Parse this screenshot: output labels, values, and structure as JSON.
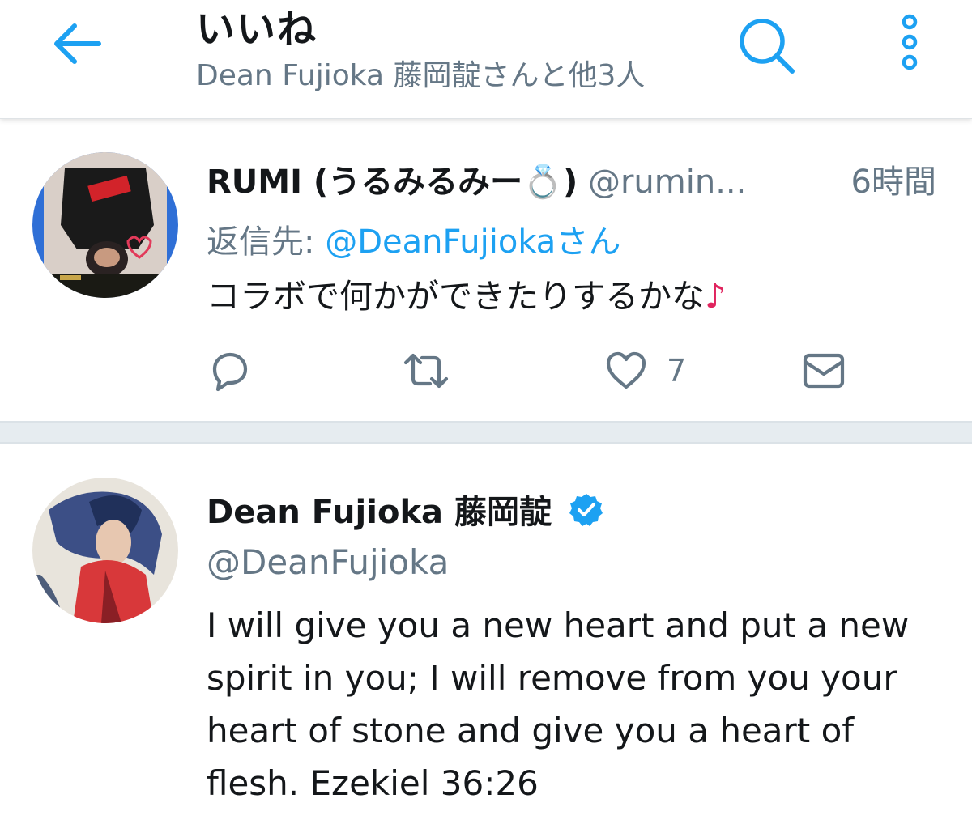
{
  "header": {
    "title": "いいね",
    "subtitle": "Dean Fujioka 藤岡靛さんと他3人"
  },
  "colors": {
    "accent": "#1da1f2",
    "secondary_text": "#657786",
    "primary_text": "#14171a",
    "divider": "#e6ecf0",
    "note": "#e0245e",
    "verified": "#1da1f2"
  },
  "icons": {
    "back": "arrow-left-icon",
    "search": "search-icon",
    "more": "more-vertical-icon",
    "reply": "reply-icon",
    "retweet": "retweet-icon",
    "like": "heart-icon",
    "dm": "envelope-icon",
    "verified": "verified-badge-icon"
  },
  "tweets": [
    {
      "display_name": "RUMI (うるみるみー💍)",
      "handle": "@rumin...",
      "time": "6時間",
      "reply_prefix": "返信先: ",
      "reply_to": "@DeanFujiokaさん",
      "text": "コラボで何かができたりするかな",
      "text_suffix": "♪",
      "like_count": "7"
    },
    {
      "display_name": "Dean Fujioka 藤岡靛",
      "verified": true,
      "handle": "@DeanFujioka",
      "text": "I will give you a new heart and put a new spirit in you; I will remove from you your heart of stone and give you a heart of flesh. Ezekiel 36:26"
    }
  ]
}
